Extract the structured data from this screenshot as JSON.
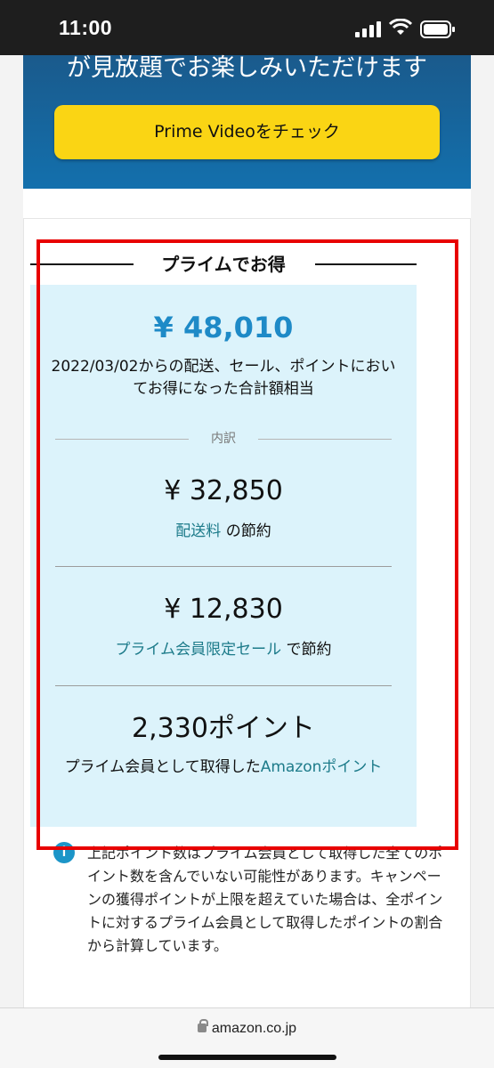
{
  "status_bar": {
    "time": "11:00"
  },
  "promo": {
    "headline": "が見放題でお楽しみいただけます",
    "button_label": "Prime Videoをチェック"
  },
  "savings": {
    "title": "プライムでお得",
    "total_amount": "¥ 48,010",
    "total_description": "2022/03/02からの配送、セール、ポイントにおいてお得になった合計額相当",
    "breakdown_label": "内訳",
    "items": [
      {
        "amount": "¥ 32,850",
        "link_text": "配送料",
        "suffix": "の節約"
      },
      {
        "amount": "¥ 12,830",
        "link_text": "プライム会員限定セール",
        "suffix": "で節約"
      },
      {
        "amount": "2,330ポイント",
        "prefix": "プライム会員として取得した",
        "link_text": "Amazonポイント"
      }
    ]
  },
  "note": {
    "icon": "info-icon",
    "text": "上記ポイント数はプライム会員として取得した全てのポイント数を含んでいない可能性があります。キャンペーンの獲得ポイントが上限を超えていた場合は、全ポイントに対するプライム会員として取得したポイントの割合から計算しています。"
  },
  "browser": {
    "url": "amazon.co.jp"
  },
  "colors": {
    "accent_blue": "#1e8ac7",
    "link_teal": "#1d7b8a",
    "button_yellow": "#fad514",
    "highlight_red": "#e80000",
    "box_bg": "#dcf3fb"
  }
}
